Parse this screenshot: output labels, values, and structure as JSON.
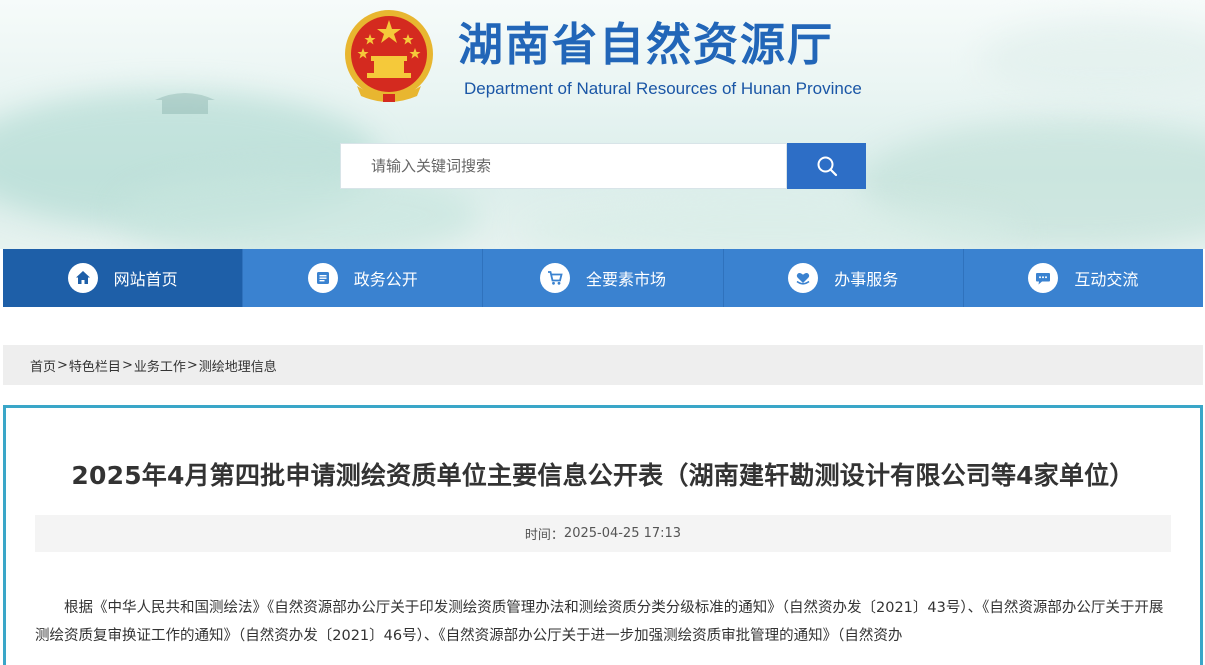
{
  "header": {
    "title": "湖南省自然资源厅",
    "subtitle": "Department of Natural Resources of Hunan Province",
    "emblem_icon": "national-emblem-icon"
  },
  "search": {
    "placeholder": "请输入关键词搜索",
    "button_icon": "search-icon"
  },
  "nav": {
    "items": [
      {
        "label": "网站首页",
        "icon": "home-icon",
        "active": true
      },
      {
        "label": "政务公开",
        "icon": "document-icon",
        "active": false
      },
      {
        "label": "全要素市场",
        "icon": "cart-icon",
        "active": false
      },
      {
        "label": "办事服务",
        "icon": "heart-hand-icon",
        "active": false
      },
      {
        "label": "互动交流",
        "icon": "chat-icon",
        "active": false
      }
    ]
  },
  "breadcrumb": {
    "items": [
      "首页",
      "特色栏目",
      "业务工作",
      "测绘地理信息"
    ],
    "separator": ">"
  },
  "article": {
    "title": "2025年4月第四批申请测绘资质单位主要信息公开表（湖南建轩勘测设计有限公司等4家单位）",
    "time_label": "时间：",
    "time_value": "2025-04-25 17:13",
    "body": "根据《中华人民共和国测绘法》《自然资源部办公厅关于印发测绘资质管理办法和测绘资质分类分级标准的通知》（自然资办发〔2021〕43号）、《自然资源部办公厅关于开展测绘资质复审换证工作的通知》（自然资办发〔2021〕46号）、《自然资源部办公厅关于进一步加强测绘资质审批管理的通知》（自然资办"
  },
  "colors": {
    "brand_blue": "#2266b8",
    "nav_blue": "#3a82d0",
    "nav_active": "#1e5fa8",
    "article_border": "#3aa6c8"
  }
}
